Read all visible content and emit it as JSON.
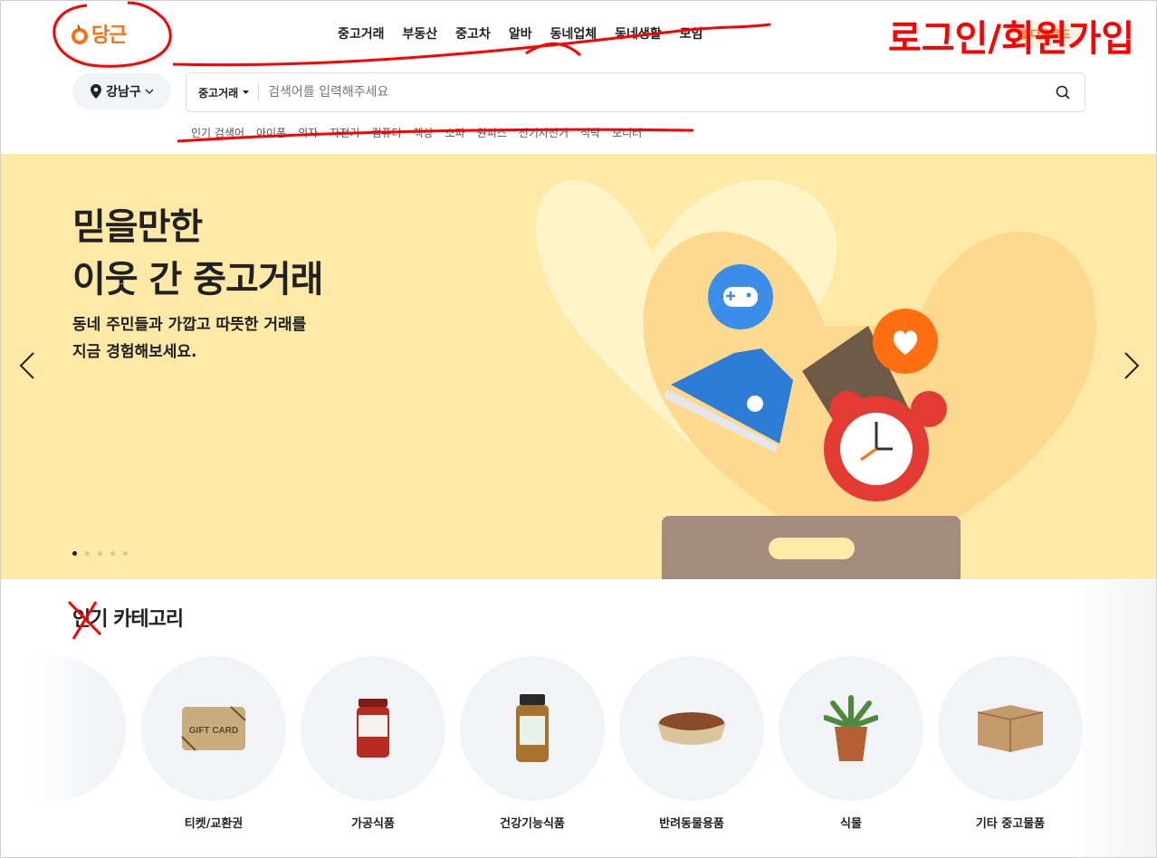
{
  "header": {
    "logo_text": "당근",
    "nav": [
      "중고거래",
      "부동산",
      "중고차",
      "알바",
      "동네업체",
      "동네생활",
      "모임"
    ],
    "app_download": "앱 다운로드"
  },
  "location": {
    "label": "강남구"
  },
  "search": {
    "category": "중고거래",
    "placeholder": "검색어를 입력해주세요"
  },
  "keywords": [
    "인기 검색어",
    "아이폰",
    "의자",
    "자전거",
    "컴퓨터",
    "책상",
    "소파",
    "원피스",
    "전기자전거",
    "식탁",
    "모니터"
  ],
  "hero": {
    "title_line1": "믿을만한",
    "title_line2": "이웃 간 중고거래",
    "sub_line1": "동네 주민들과 가깝고 따뜻한 거래를",
    "sub_line2": "지금 경험해보세요.",
    "slide_index": 1,
    "slide_count": 5
  },
  "categories": {
    "title": "인기 카테고리",
    "items": [
      "티켓/교환권",
      "가공식품",
      "건강기능식품",
      "반려동물용품",
      "식물",
      "기타 중고물품"
    ]
  },
  "annotations": {
    "handwritten_text": "로그인/회원가입",
    "color": "#ff0000"
  },
  "colors": {
    "brand": "#ff6f0f",
    "hero_bg": "#fee9a6"
  }
}
